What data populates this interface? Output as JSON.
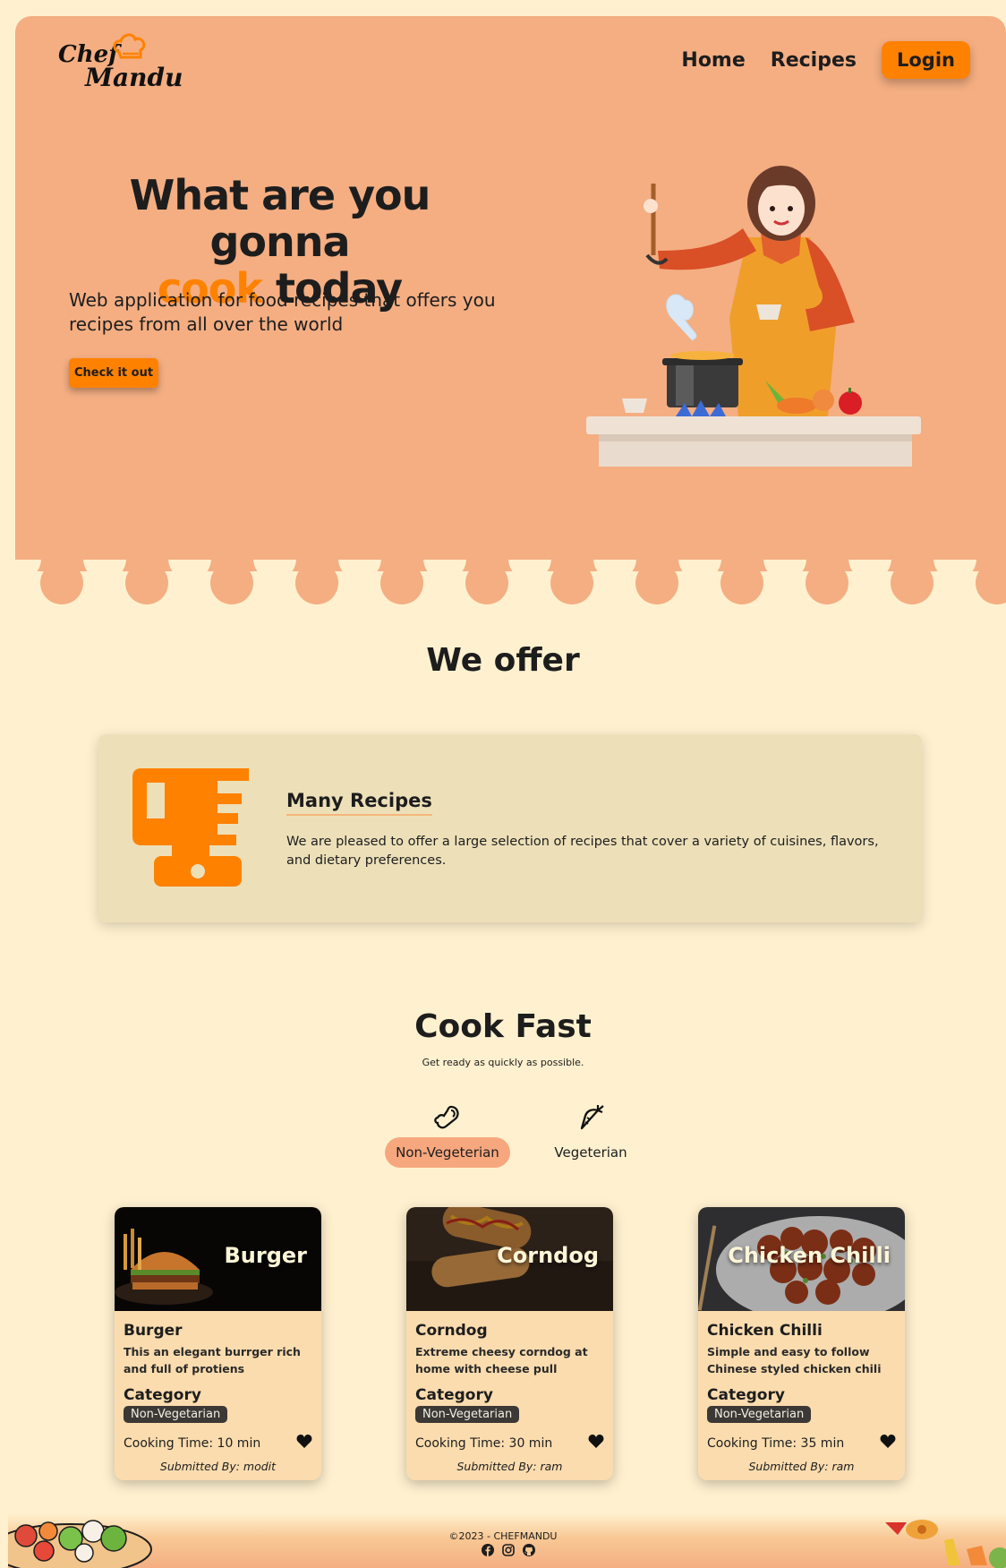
{
  "brand": {
    "line1": "Chef",
    "line2": "Mandu"
  },
  "nav": {
    "home": "Home",
    "recipes": "Recipes",
    "login": "Login"
  },
  "hero": {
    "title_line1": "What are you gonna",
    "title_accent": "cook",
    "title_rest": " today",
    "subtitle": "Web application for food recipes that offers you recipes from all over the world",
    "cta": "Check it out"
  },
  "offer": {
    "title": "We offer",
    "card_heading": "Many Recipes",
    "card_text": "We are pleased to offer a large selection of recipes that cover a variety of cuisines, flavors, and dietary preferences.",
    "icon": "blender-icon"
  },
  "cook_fast": {
    "title": "Cook Fast",
    "subtitle": "Get ready as quickly as possible.",
    "tabs": [
      {
        "label": "Non-Vegeterian",
        "icon": "drumstick-icon",
        "active": true
      },
      {
        "label": "Vegeterian",
        "icon": "carrot-icon",
        "active": false
      }
    ],
    "cards": [
      {
        "image_title": "Burger",
        "name": "Burger",
        "description": "This an elegant burrger rich and full of protiens",
        "category_label": "Category",
        "category": "Non-Vegetarian",
        "time": "Cooking Time: 10 min",
        "submitted": "Submitted By: modit"
      },
      {
        "image_title": "Corndog",
        "name": "Corndog",
        "description": "Extreme cheesy corndog at home with cheese pull",
        "category_label": "Category",
        "category": "Non-Vegetarian",
        "time": "Cooking Time: 30 min",
        "submitted": "Submitted By: ram"
      },
      {
        "image_title": "Chicken Chilli",
        "name": "Chicken Chilli",
        "description": "Simple and easy to follow Chinese styled chicken chili",
        "category_label": "Category",
        "category": "Non-Vegetarian",
        "time": "Cooking Time: 35 min",
        "submitted": "Submitted By: ram"
      }
    ]
  },
  "footer": {
    "copyright": "©2023 - CHEFMANDU",
    "icons": [
      "facebook-icon",
      "instagram-icon",
      "github-icon"
    ]
  },
  "colors": {
    "accent": "#ff8100",
    "hero_bg": "#f4ae82",
    "page_bg": "#fff1cf",
    "card_bg": "#fbdcae",
    "offer_bg": "#ede0b9"
  }
}
